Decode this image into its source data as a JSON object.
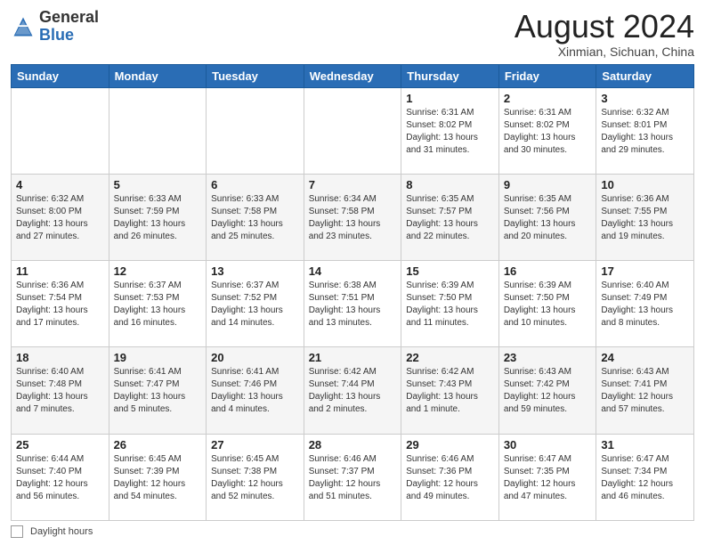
{
  "header": {
    "logo_general": "General",
    "logo_blue": "Blue",
    "main_title": "August 2024",
    "subtitle": "Xinmian, Sichuan, China"
  },
  "weekdays": [
    "Sunday",
    "Monday",
    "Tuesday",
    "Wednesday",
    "Thursday",
    "Friday",
    "Saturday"
  ],
  "weeks": [
    [
      {
        "day": "",
        "info": ""
      },
      {
        "day": "",
        "info": ""
      },
      {
        "day": "",
        "info": ""
      },
      {
        "day": "",
        "info": ""
      },
      {
        "day": "1",
        "info": "Sunrise: 6:31 AM\nSunset: 8:02 PM\nDaylight: 13 hours\nand 31 minutes."
      },
      {
        "day": "2",
        "info": "Sunrise: 6:31 AM\nSunset: 8:02 PM\nDaylight: 13 hours\nand 30 minutes."
      },
      {
        "day": "3",
        "info": "Sunrise: 6:32 AM\nSunset: 8:01 PM\nDaylight: 13 hours\nand 29 minutes."
      }
    ],
    [
      {
        "day": "4",
        "info": "Sunrise: 6:32 AM\nSunset: 8:00 PM\nDaylight: 13 hours\nand 27 minutes."
      },
      {
        "day": "5",
        "info": "Sunrise: 6:33 AM\nSunset: 7:59 PM\nDaylight: 13 hours\nand 26 minutes."
      },
      {
        "day": "6",
        "info": "Sunrise: 6:33 AM\nSunset: 7:58 PM\nDaylight: 13 hours\nand 25 minutes."
      },
      {
        "day": "7",
        "info": "Sunrise: 6:34 AM\nSunset: 7:58 PM\nDaylight: 13 hours\nand 23 minutes."
      },
      {
        "day": "8",
        "info": "Sunrise: 6:35 AM\nSunset: 7:57 PM\nDaylight: 13 hours\nand 22 minutes."
      },
      {
        "day": "9",
        "info": "Sunrise: 6:35 AM\nSunset: 7:56 PM\nDaylight: 13 hours\nand 20 minutes."
      },
      {
        "day": "10",
        "info": "Sunrise: 6:36 AM\nSunset: 7:55 PM\nDaylight: 13 hours\nand 19 minutes."
      }
    ],
    [
      {
        "day": "11",
        "info": "Sunrise: 6:36 AM\nSunset: 7:54 PM\nDaylight: 13 hours\nand 17 minutes."
      },
      {
        "day": "12",
        "info": "Sunrise: 6:37 AM\nSunset: 7:53 PM\nDaylight: 13 hours\nand 16 minutes."
      },
      {
        "day": "13",
        "info": "Sunrise: 6:37 AM\nSunset: 7:52 PM\nDaylight: 13 hours\nand 14 minutes."
      },
      {
        "day": "14",
        "info": "Sunrise: 6:38 AM\nSunset: 7:51 PM\nDaylight: 13 hours\nand 13 minutes."
      },
      {
        "day": "15",
        "info": "Sunrise: 6:39 AM\nSunset: 7:50 PM\nDaylight: 13 hours\nand 11 minutes."
      },
      {
        "day": "16",
        "info": "Sunrise: 6:39 AM\nSunset: 7:50 PM\nDaylight: 13 hours\nand 10 minutes."
      },
      {
        "day": "17",
        "info": "Sunrise: 6:40 AM\nSunset: 7:49 PM\nDaylight: 13 hours\nand 8 minutes."
      }
    ],
    [
      {
        "day": "18",
        "info": "Sunrise: 6:40 AM\nSunset: 7:48 PM\nDaylight: 13 hours\nand 7 minutes."
      },
      {
        "day": "19",
        "info": "Sunrise: 6:41 AM\nSunset: 7:47 PM\nDaylight: 13 hours\nand 5 minutes."
      },
      {
        "day": "20",
        "info": "Sunrise: 6:41 AM\nSunset: 7:46 PM\nDaylight: 13 hours\nand 4 minutes."
      },
      {
        "day": "21",
        "info": "Sunrise: 6:42 AM\nSunset: 7:44 PM\nDaylight: 13 hours\nand 2 minutes."
      },
      {
        "day": "22",
        "info": "Sunrise: 6:42 AM\nSunset: 7:43 PM\nDaylight: 13 hours\nand 1 minute."
      },
      {
        "day": "23",
        "info": "Sunrise: 6:43 AM\nSunset: 7:42 PM\nDaylight: 12 hours\nand 59 minutes."
      },
      {
        "day": "24",
        "info": "Sunrise: 6:43 AM\nSunset: 7:41 PM\nDaylight: 12 hours\nand 57 minutes."
      }
    ],
    [
      {
        "day": "25",
        "info": "Sunrise: 6:44 AM\nSunset: 7:40 PM\nDaylight: 12 hours\nand 56 minutes."
      },
      {
        "day": "26",
        "info": "Sunrise: 6:45 AM\nSunset: 7:39 PM\nDaylight: 12 hours\nand 54 minutes."
      },
      {
        "day": "27",
        "info": "Sunrise: 6:45 AM\nSunset: 7:38 PM\nDaylight: 12 hours\nand 52 minutes."
      },
      {
        "day": "28",
        "info": "Sunrise: 6:46 AM\nSunset: 7:37 PM\nDaylight: 12 hours\nand 51 minutes."
      },
      {
        "day": "29",
        "info": "Sunrise: 6:46 AM\nSunset: 7:36 PM\nDaylight: 12 hours\nand 49 minutes."
      },
      {
        "day": "30",
        "info": "Sunrise: 6:47 AM\nSunset: 7:35 PM\nDaylight: 12 hours\nand 47 minutes."
      },
      {
        "day": "31",
        "info": "Sunrise: 6:47 AM\nSunset: 7:34 PM\nDaylight: 12 hours\nand 46 minutes."
      }
    ]
  ],
  "footer": {
    "label": "Daylight hours"
  }
}
